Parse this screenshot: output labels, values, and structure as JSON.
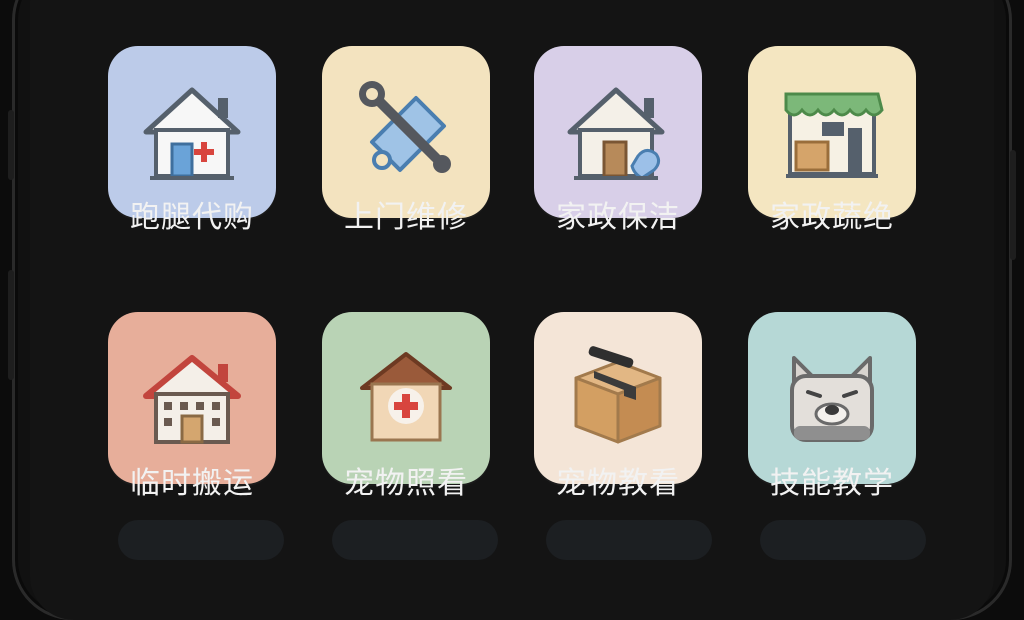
{
  "colors": {
    "tile_1": "#bccbe9",
    "tile_2": "#f3e3bf",
    "tile_3": "#d8cfe8",
    "tile_4": "#f4e6c1",
    "tile_5": "#e7ae9a",
    "tile_6": "#b9d3b5",
    "tile_7": "#f4e5d7",
    "tile_8": "#b6d8d6",
    "label_text": "#f2f2f2"
  },
  "grid": {
    "items": [
      {
        "label": "跑腿代购",
        "icon": "house-medical-icon"
      },
      {
        "label": "上门维修",
        "icon": "wrench-tag-icon"
      },
      {
        "label": "家政保洁",
        "icon": "house-hand-icon"
      },
      {
        "label": "家政蔬绝",
        "icon": "shop-box-icon"
      },
      {
        "label": "临时搬运",
        "icon": "building-icon"
      },
      {
        "label": "宠物照看",
        "icon": "pet-house-icon"
      },
      {
        "label": "宠物教看",
        "icon": "package-box-icon"
      },
      {
        "label": "技能教学",
        "icon": "dog-face-icon"
      }
    ]
  }
}
